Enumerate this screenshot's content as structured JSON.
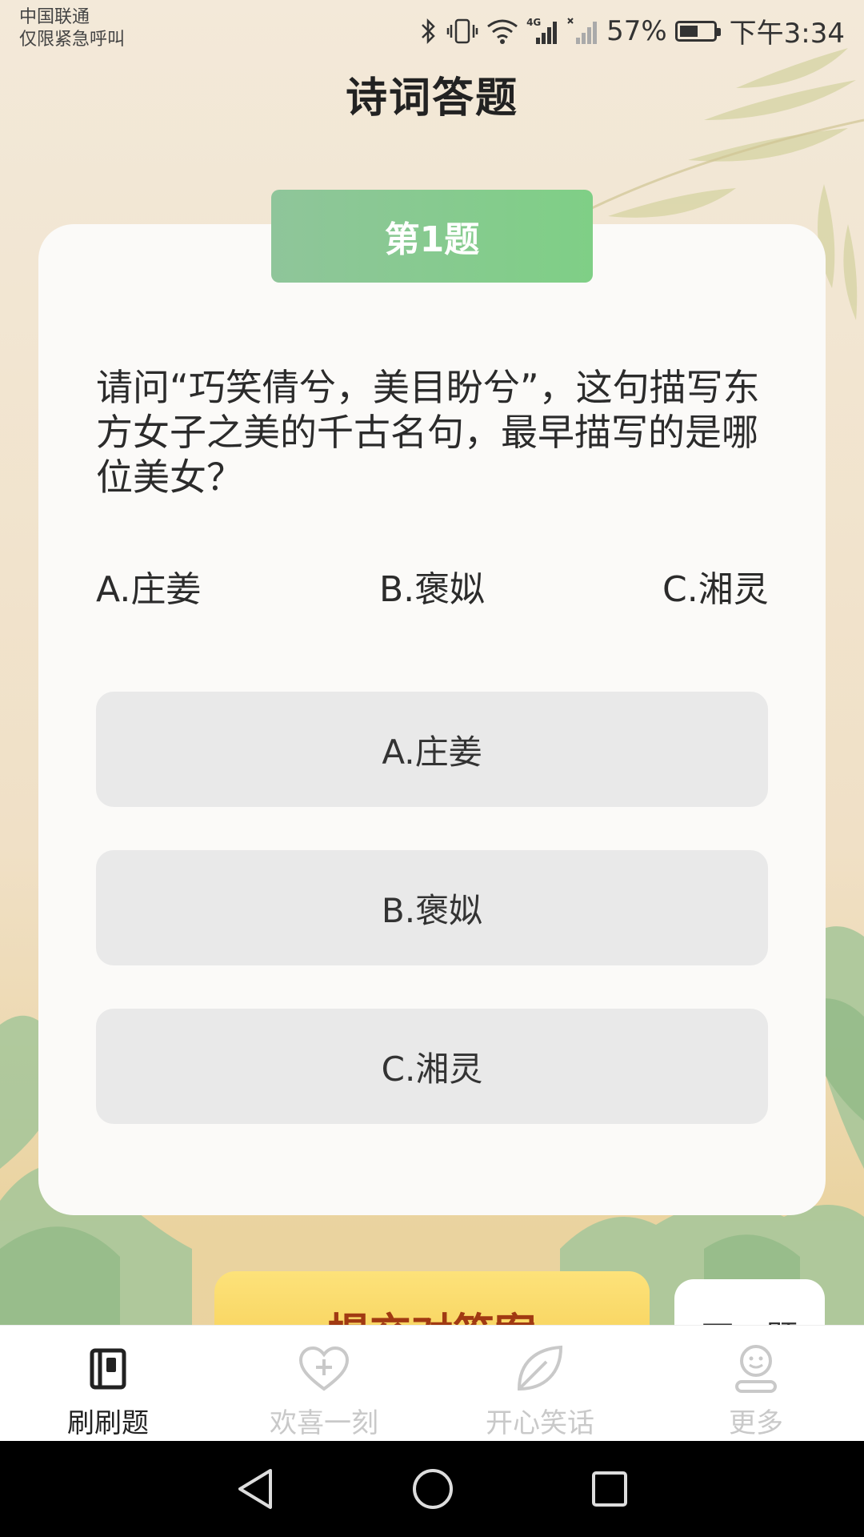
{
  "status_bar": {
    "carrier_line1": "中国联通",
    "carrier_line2": "仅限紧急呼叫",
    "network_label": "4G",
    "battery_percent": "57%",
    "battery_level": 0.57,
    "time": "下午3:34"
  },
  "header": {
    "title": "诗词答题"
  },
  "quiz": {
    "badge": "第1题",
    "question": "请问“巧笑倩兮，美目盼兮”，这句描写东方女子之美的千古名句，最早描写的是哪位美女？",
    "options_inline": [
      "A.庄姜",
      "B.褒姒",
      "C.湘灵"
    ],
    "option_buttons": [
      "A.庄姜",
      "B.褒姒",
      "C.湘灵"
    ]
  },
  "actions": {
    "submit_label": "提交对答案",
    "next_label": "下一题"
  },
  "tab_bar": {
    "items": [
      {
        "label": "刷刷题",
        "icon": "book-icon",
        "active": true
      },
      {
        "label": "欢喜一刻",
        "icon": "heart-plus-icon",
        "active": false
      },
      {
        "label": "开心笑话",
        "icon": "leaf-icon",
        "active": false
      },
      {
        "label": "更多",
        "icon": "person-icon",
        "active": false
      }
    ]
  },
  "nav_bar": {
    "back": "back-icon",
    "home": "home-icon",
    "recents": "recents-icon"
  },
  "colors": {
    "badge_green": "#7fcf86",
    "submit_yellow": "#f6cf55",
    "submit_text": "#a13a12",
    "option_bg": "#e9e9e9",
    "tab_inactive": "#c9c9c9"
  }
}
